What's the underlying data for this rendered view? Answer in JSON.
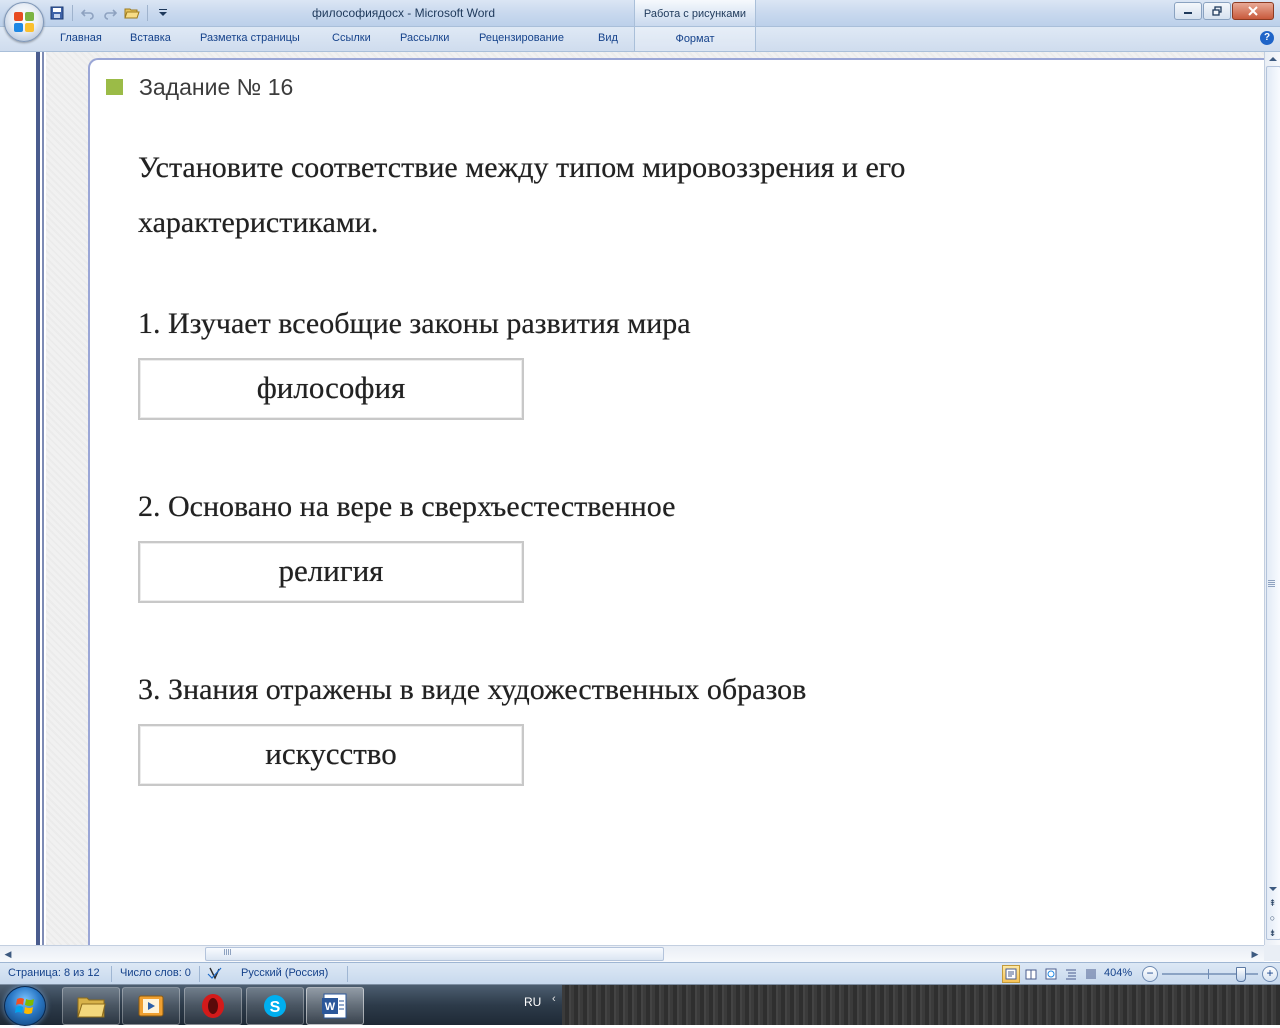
{
  "window": {
    "title": "философиядocx - Microsoft Word",
    "contextual_tab_group": "Работа с рисунками",
    "controls": [
      "minimize-icon",
      "restore-icon",
      "close-icon"
    ]
  },
  "quick_access": [
    "save-icon",
    "undo-icon",
    "redo-icon",
    "open-folder-icon",
    "customize-dropdown-icon"
  ],
  "ribbon": {
    "tabs": [
      "Главная",
      "Вставка",
      "Разметка страницы",
      "Ссылки",
      "Рассылки",
      "Рецензирование",
      "Вид"
    ],
    "contextual_tab": "Формат"
  },
  "slide": {
    "task_title": "Задание № 16",
    "question": "Установите соответствие между типом мировоззрения и его характеристиками.",
    "items": [
      {
        "text": "1. Изучает всеобщие законы развития мира",
        "answer": "философия"
      },
      {
        "text": "2. Основано на вере в сверхъестественное",
        "answer": "религия"
      },
      {
        "text": "3. Знания отражены в виде художественных образов",
        "answer": "искусство"
      }
    ],
    "accent_color": "#9bbb47"
  },
  "statusbar": {
    "page": "Страница: 8 из 12",
    "words": "Число слов: 0",
    "language": "Русский (Россия)",
    "zoom": "404%"
  },
  "taskbar": {
    "apps": [
      "windows-explorer",
      "media-player",
      "opera",
      "skype",
      "microsoft-word"
    ],
    "active_app": "microsoft-word",
    "language": "RU"
  }
}
